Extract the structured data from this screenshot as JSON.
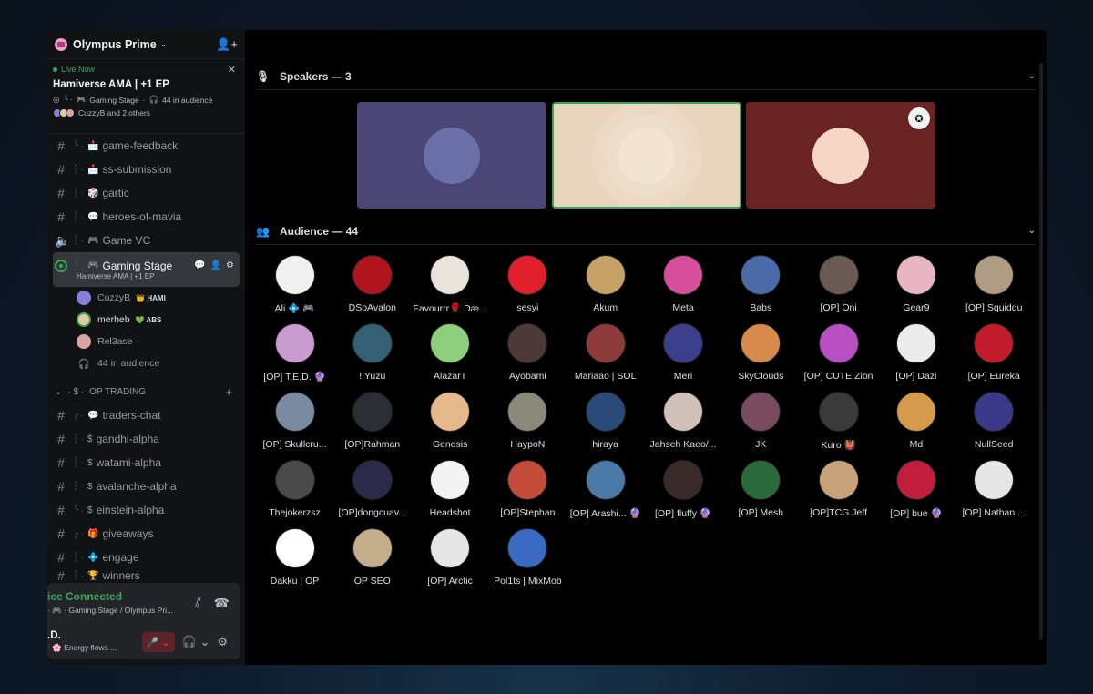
{
  "server": {
    "name": "Olympus Prime"
  },
  "live": {
    "status": "Live Now",
    "title": "Hamiverse AMA | +1 EP",
    "channel": "Gaming Stage",
    "audience": "44 in audience",
    "speakers_text": "CuzzyB and 2 others"
  },
  "channels": [
    {
      "name": "game-feedback",
      "emoji": "📩",
      "type": "text"
    },
    {
      "name": "ss-submission",
      "emoji": "📩",
      "type": "text"
    },
    {
      "name": "gartic",
      "emoji": "🎲",
      "type": "text"
    },
    {
      "name": "heroes-of-mavia",
      "emoji": "💬",
      "type": "text"
    },
    {
      "name": "Game VC",
      "emoji": "",
      "type": "voice"
    }
  ],
  "stage_channel": {
    "name": "Gaming Stage",
    "subtitle": "Hamiverse AMA | +1 EP",
    "members": [
      {
        "name": "CuzzyB",
        "tag": "HAMI",
        "color": "#8a7fd6"
      },
      {
        "name": "merheb",
        "tag": "ABS",
        "color": "#e3c9a4"
      },
      {
        "name": "Rel3ase",
        "tag": "",
        "color": "#d8a4a4"
      }
    ],
    "audience": "44 in audience"
  },
  "category": {
    "name": "OP TRADING"
  },
  "trading_channels": [
    {
      "name": "traders-chat",
      "emoji": "💬"
    },
    {
      "name": "gandhi-alpha",
      "emoji": "$"
    },
    {
      "name": "watami-alpha",
      "emoji": "$"
    },
    {
      "name": "avalanche-alpha",
      "emoji": "$"
    },
    {
      "name": "einstein-alpha",
      "emoji": "$"
    },
    {
      "name": "giveaways",
      "emoji": "🎁"
    },
    {
      "name": "engage",
      "emoji": "💠"
    },
    {
      "name": "winners",
      "emoji": "🏆"
    }
  ],
  "voice_panel": {
    "status": "ice Connected",
    "location": "Gaming Stage / Olympus Pri..."
  },
  "user_panel": {
    "name": ".D.",
    "status": "Energy flows ..."
  },
  "speakers": {
    "title": "Speakers — 3",
    "items": [
      {
        "color": "#4c4676",
        "avatar": "#6b6fa8"
      },
      {
        "color": "#e9d5bd",
        "avatar": "#f2e6d3"
      },
      {
        "color": "#6a2323",
        "avatar": "#f6d7c6"
      }
    ]
  },
  "audience": {
    "title": "Audience — 44",
    "items": [
      {
        "name": "Ali 💠 🎮",
        "color": "#f0f0f0"
      },
      {
        "name": "DSoAvalon",
        "color": "#b0141c"
      },
      {
        "name": "Favourrr🌹 Dæ...",
        "color": "#e9e3da"
      },
      {
        "name": "sesyi",
        "color": "#e01f2b"
      },
      {
        "name": "Akum",
        "color": "#c7a266"
      },
      {
        "name": "Meta",
        "color": "#d64f9b"
      },
      {
        "name": "Babs",
        "color": "#4b6ba8"
      },
      {
        "name": "[OP] Oni",
        "color": "#6b5a54"
      },
      {
        "name": "Gear9",
        "color": "#e7b5c4"
      },
      {
        "name": "[OP] Squiddu",
        "color": "#b09b84"
      },
      {
        "name": "[OP] T.E.D. 🔮",
        "color": "#c99bd0"
      },
      {
        "name": "! Yuzu",
        "color": "#355f75"
      },
      {
        "name": "AlazarT",
        "color": "#8dcf7d"
      },
      {
        "name": "Ayobami",
        "color": "#4b3a36"
      },
      {
        "name": "Mariaao | SOL",
        "color": "#8d3a3a"
      },
      {
        "name": "Meri",
        "color": "#3b3f8c"
      },
      {
        "name": "SkyClouds",
        "color": "#d88a4c"
      },
      {
        "name": "[OP] CUTE Zion",
        "color": "#b94fc2"
      },
      {
        "name": "[OP] Dazi",
        "color": "#ececec"
      },
      {
        "name": "[OP] Eureka",
        "color": "#c21d2d"
      },
      {
        "name": "[OP] Skullcru...",
        "color": "#7a8aa0"
      },
      {
        "name": "[OP]Rahman",
        "color": "#2c2e36"
      },
      {
        "name": "Genesis",
        "color": "#e6b98c"
      },
      {
        "name": "HaypoN",
        "color": "#8a8a7a"
      },
      {
        "name": "hiraya",
        "color": "#2a4a7a"
      },
      {
        "name": "Jahseh Kaeo/...",
        "color": "#d0c2b8"
      },
      {
        "name": "JK",
        "color": "#7a4a5e"
      },
      {
        "name": "Kuro 👹",
        "color": "#3a3a3a"
      },
      {
        "name": "Md",
        "color": "#d69a4c"
      },
      {
        "name": "NullSeed",
        "color": "#3a3a8a"
      },
      {
        "name": "Thejokerzsz",
        "color": "#4a4a4a"
      },
      {
        "name": "[OP]dongcuav...",
        "color": "#2c2a4a"
      },
      {
        "name": "Headshot",
        "color": "#f4f4f4"
      },
      {
        "name": "[OP]Stephan",
        "color": "#c44a3a"
      },
      {
        "name": "[OP] Arashi... 🔮",
        "color": "#4a7aa8"
      },
      {
        "name": "[OP] fluffy 🔮",
        "color": "#3a2a2a"
      },
      {
        "name": "[OP] Mesh",
        "color": "#2a6a3a"
      },
      {
        "name": "[OP]TCG Jeff",
        "color": "#c8a27a"
      },
      {
        "name": "[OP] bue 🔮",
        "color": "#c21d3d"
      },
      {
        "name": "[OP] Nathan ...",
        "color": "#e6e6e6"
      },
      {
        "name": "Dakku | OP",
        "color": "#ffffff"
      },
      {
        "name": "OP SEO",
        "color": "#c4ad8a"
      },
      {
        "name": "[OP] Arctic",
        "color": "#e6e6e6"
      },
      {
        "name": "Pol1ts | MixMob",
        "color": "#3a6ac4"
      }
    ]
  }
}
